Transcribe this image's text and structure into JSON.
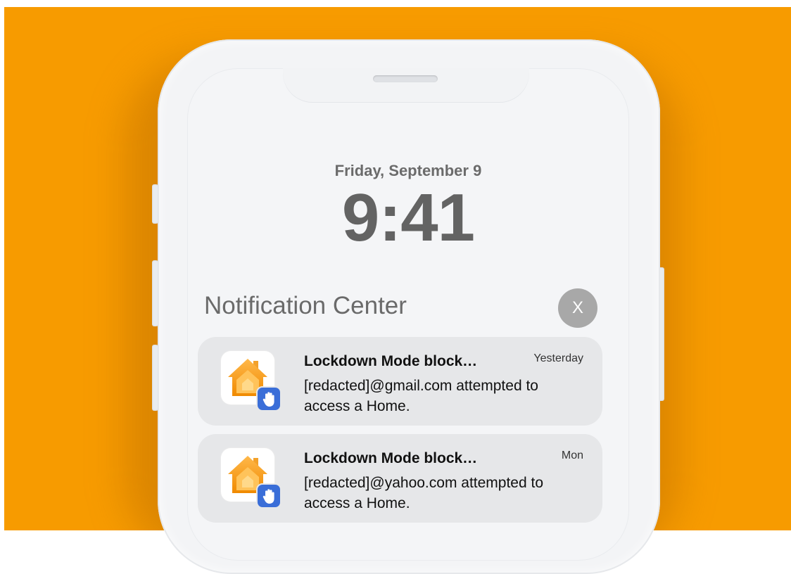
{
  "lock_screen": {
    "date": "Friday, September 9",
    "time": "9:41"
  },
  "notification_center": {
    "title": "Notification Center",
    "close_label": "X"
  },
  "notifications": [
    {
      "app_icon": "home-icon",
      "badge_icon": "hand-stop-icon",
      "title": "Lockdown Mode block…",
      "time": "Yesterday",
      "body": "[redacted]@gmail.com attempted to access a Home."
    },
    {
      "app_icon": "home-icon",
      "badge_icon": "hand-stop-icon",
      "title": "Lockdown Mode block…",
      "time": "Mon",
      "body": "[redacted]@yahoo.com attempted to access a Home."
    }
  ],
  "colors": {
    "background": "#f79b00",
    "badge": "#3a6ed8",
    "home_icon": "#f5a623"
  }
}
